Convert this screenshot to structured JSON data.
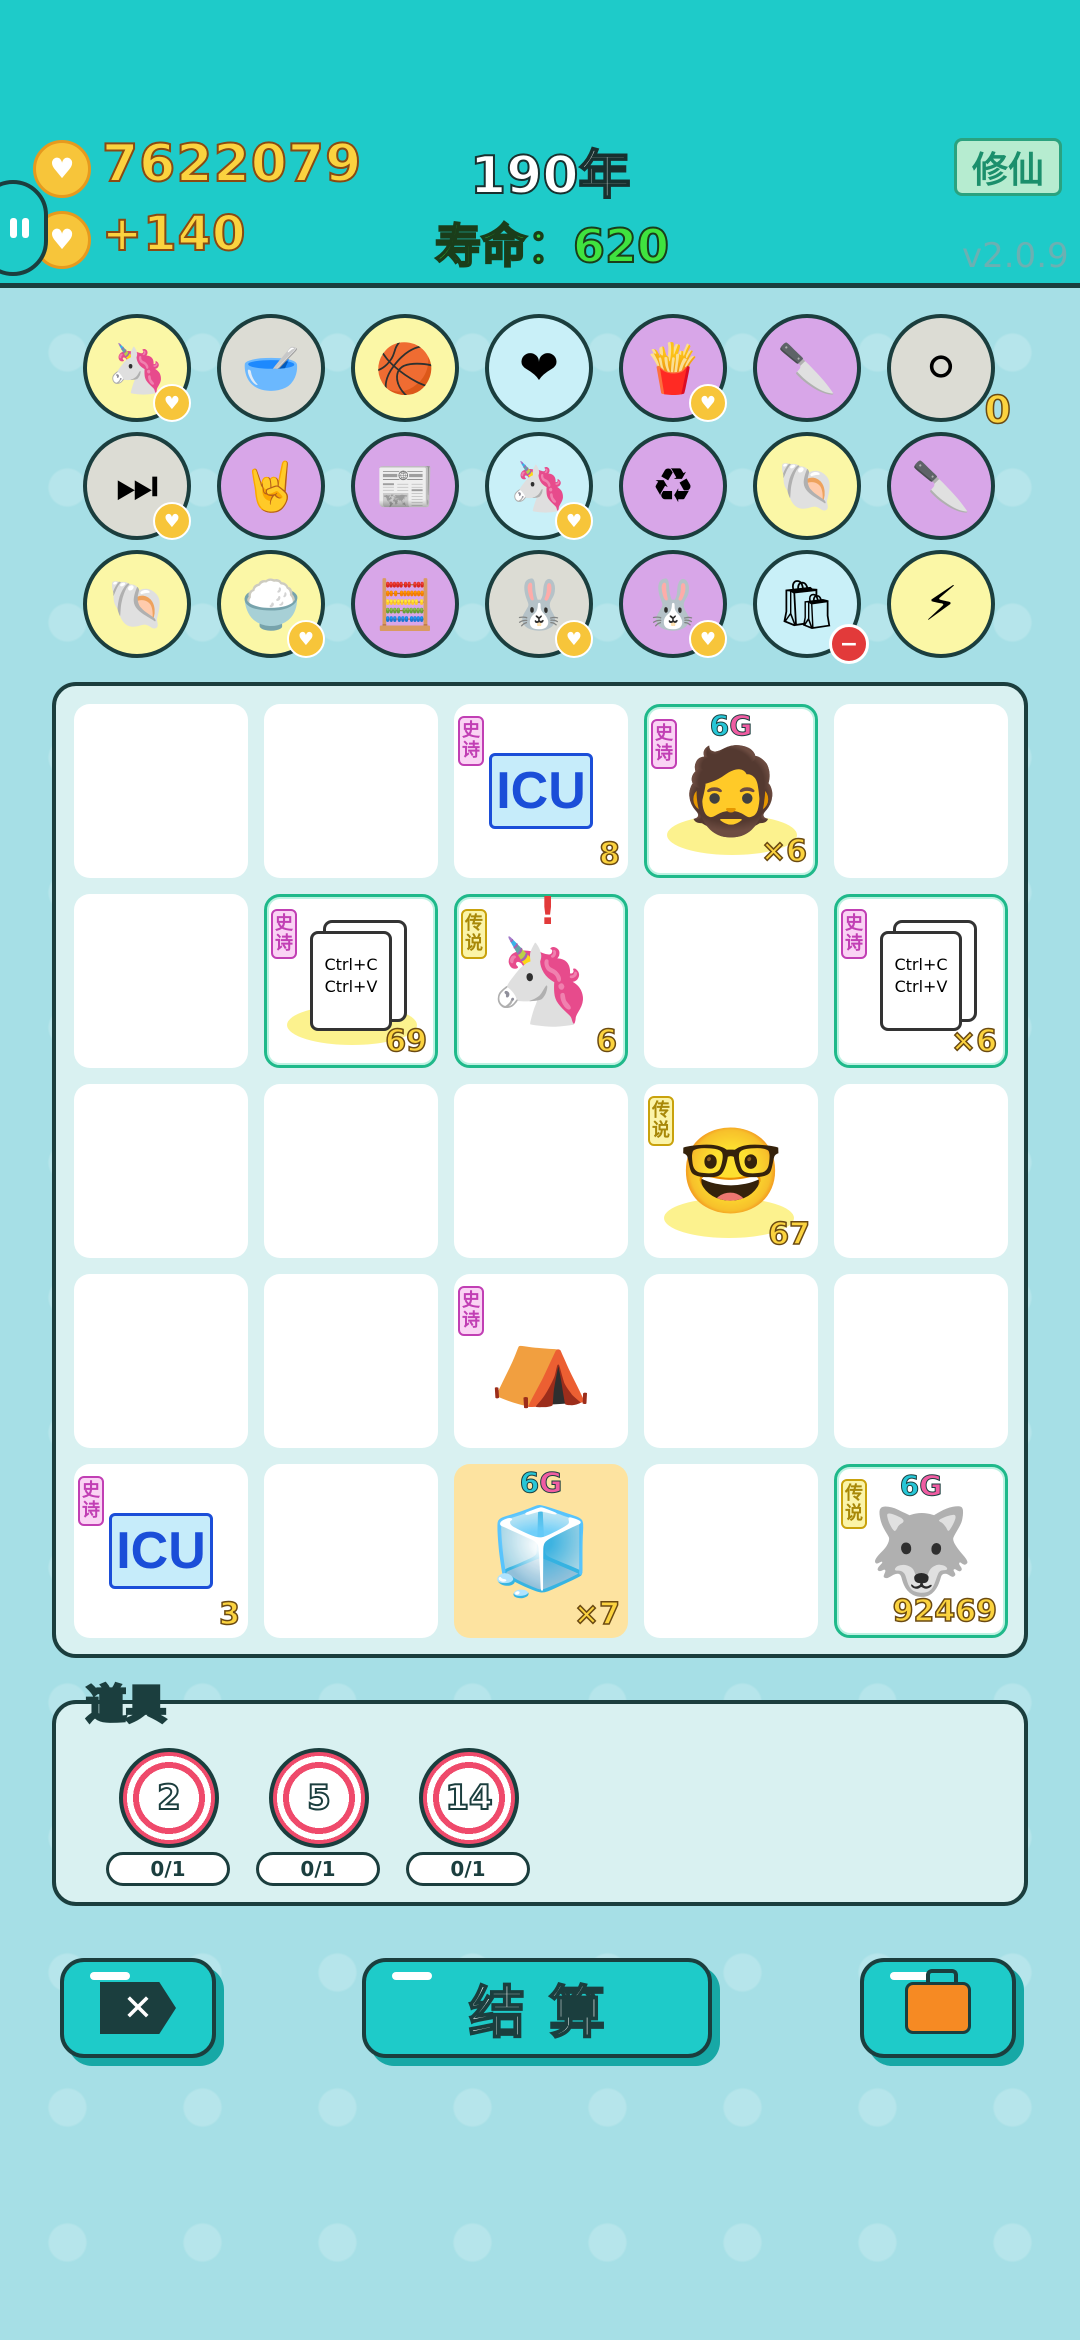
{
  "header": {
    "coins": "7622079",
    "income": "+140",
    "year": "190年",
    "lifespan": "寿命：620",
    "xiuxian_label": "修仙",
    "version": "v2.0.9",
    "coin_icon": "heart-coin-icon"
  },
  "inventory_items": [
    {
      "icon": "unicorn-icon",
      "bg": "#fbf7a6",
      "heart": true
    },
    {
      "icon": "dog-food-bowl-icon",
      "bg": "#dcdcd4"
    },
    {
      "icon": "basketballs-icon",
      "bg": "#fbf7a6"
    },
    {
      "icon": "heart-fan-icon",
      "bg": "#c9f0f8"
    },
    {
      "icon": "french-fries-icon",
      "bg": "#d8a6e8",
      "heart": true
    },
    {
      "icon": "cleaver-icon",
      "bg": "#d8a6e8"
    },
    {
      "icon": "egg-tray-icon",
      "bg": "#dcdcd4",
      "count": "0"
    },
    {
      "icon": "skip-icon",
      "bg": "#dcdcd4",
      "heart": true
    },
    {
      "icon": "rock-hand-icon",
      "bg": "#d8a6e8"
    },
    {
      "icon": "time-magazine-icon",
      "bg": "#d8a6e8"
    },
    {
      "icon": "unicorn-pair-icon",
      "bg": "#c9f0f8",
      "heart": true
    },
    {
      "icon": "recycle-icon",
      "bg": "#d8a6e8"
    },
    {
      "icon": "shell-icon",
      "bg": "#fbf7a6"
    },
    {
      "icon": "cleaver-icon",
      "bg": "#d8a6e8"
    },
    {
      "icon": "shell-icon",
      "bg": "#fbf7a6"
    },
    {
      "icon": "rice-bowl-icon",
      "bg": "#fbf7a6",
      "heart": true
    },
    {
      "icon": "math-guy-icon",
      "bg": "#d8a6e8"
    },
    {
      "icon": "rabbit-icon",
      "bg": "#dcdcd4",
      "heart": true
    },
    {
      "icon": "rabbit-icon",
      "bg": "#d8a6e8",
      "heart": true
    },
    {
      "icon": "trash-bag-icon",
      "bg": "#c9f0f8",
      "minus": true
    },
    {
      "icon": "lightning-icon",
      "bg": "#fbf7a6"
    }
  ],
  "tags": {
    "epic": "史诗",
    "legend": "传说"
  },
  "board": {
    "sixg": [
      "6",
      "G"
    ],
    "ctrl_lines": [
      "Ctrl+C",
      "Ctrl+V"
    ],
    "icu_label": "ICU",
    "cells": [
      {
        "r": 0,
        "c": 2,
        "item": "icu",
        "tag": "epic",
        "qty": "8"
      },
      {
        "r": 0,
        "c": 3,
        "item": "bearded-king",
        "tag": "epic",
        "qty": "×6",
        "rare": true,
        "sixg": true
      },
      {
        "r": 1,
        "c": 1,
        "item": "ctrl-cv-king",
        "tag": "epic",
        "qty": "69",
        "rare": true
      },
      {
        "r": 1,
        "c": 2,
        "item": "unicorn",
        "tag": "legend",
        "qty": "6",
        "rare": true,
        "alert": true
      },
      {
        "r": 1,
        "c": 4,
        "item": "ctrl-cv",
        "tag": "epic",
        "qty": "×6",
        "rare": true
      },
      {
        "r": 2,
        "c": 3,
        "item": "gold-king",
        "tag": "legend",
        "qty": "67"
      },
      {
        "r": 3,
        "c": 2,
        "item": "rabbit-house",
        "tag": "epic",
        "qty": ""
      },
      {
        "r": 4,
        "c": 0,
        "item": "icu",
        "tag": "epic",
        "qty": "3"
      },
      {
        "r": 4,
        "c": 2,
        "item": "fridge",
        "qty": "×7",
        "gold": true,
        "sixg": true
      },
      {
        "r": 4,
        "c": 4,
        "item": "husky-king",
        "tag": "legend",
        "qty": "92469",
        "rare": true,
        "sixg": true
      }
    ]
  },
  "props": {
    "title": "道具",
    "items": [
      {
        "value": "2",
        "uses": "0/1"
      },
      {
        "value": "5",
        "uses": "0/1"
      },
      {
        "value": "14",
        "uses": "0/1"
      }
    ]
  },
  "actions": {
    "settle_label": "结算",
    "exit_icon": "exit-x-icon",
    "bag_icon": "briefcase-icon"
  }
}
